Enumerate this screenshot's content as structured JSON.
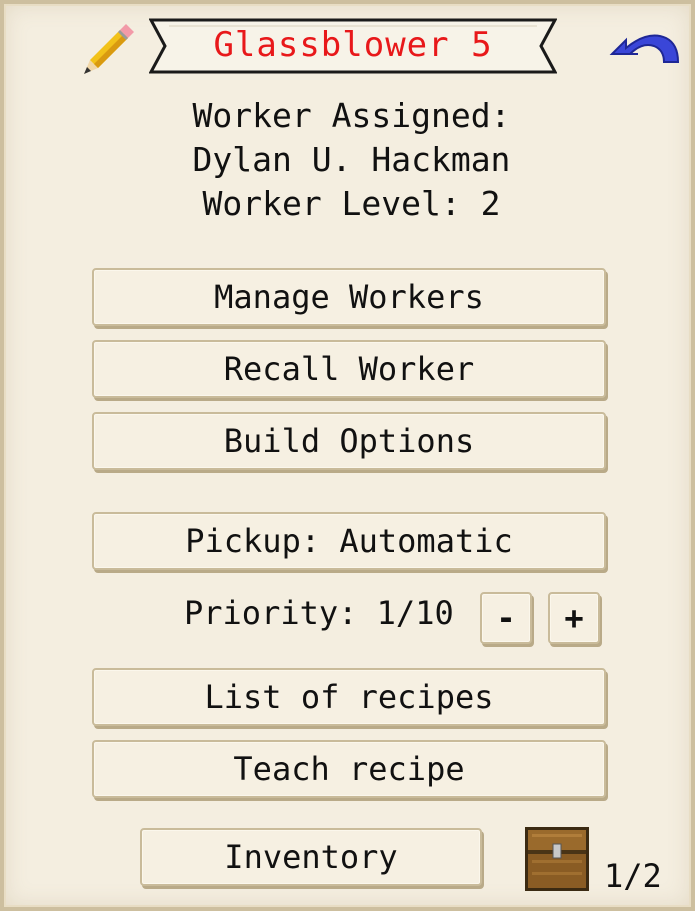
{
  "header": {
    "title": "Glassblower 5",
    "edit_icon": "pencil-icon",
    "back_icon": "curved-arrow-icon",
    "title_color": "#e8181a"
  },
  "worker": {
    "assigned_label": "Worker Assigned:",
    "name": "Dylan U. Hackman",
    "level_label": "Worker Level: 2"
  },
  "buttons": {
    "manage_workers": "Manage Workers",
    "recall_worker": "Recall Worker",
    "build_options": "Build Options",
    "pickup": "Pickup: Automatic",
    "priority_decrease": "-",
    "priority_increase": "+",
    "list_recipes": "List of recipes",
    "teach_recipe": "Teach recipe",
    "inventory": "Inventory"
  },
  "priority": {
    "label": "Priority: 1/10"
  },
  "pagination": {
    "icon": "chest-icon",
    "page": "1/2"
  }
}
